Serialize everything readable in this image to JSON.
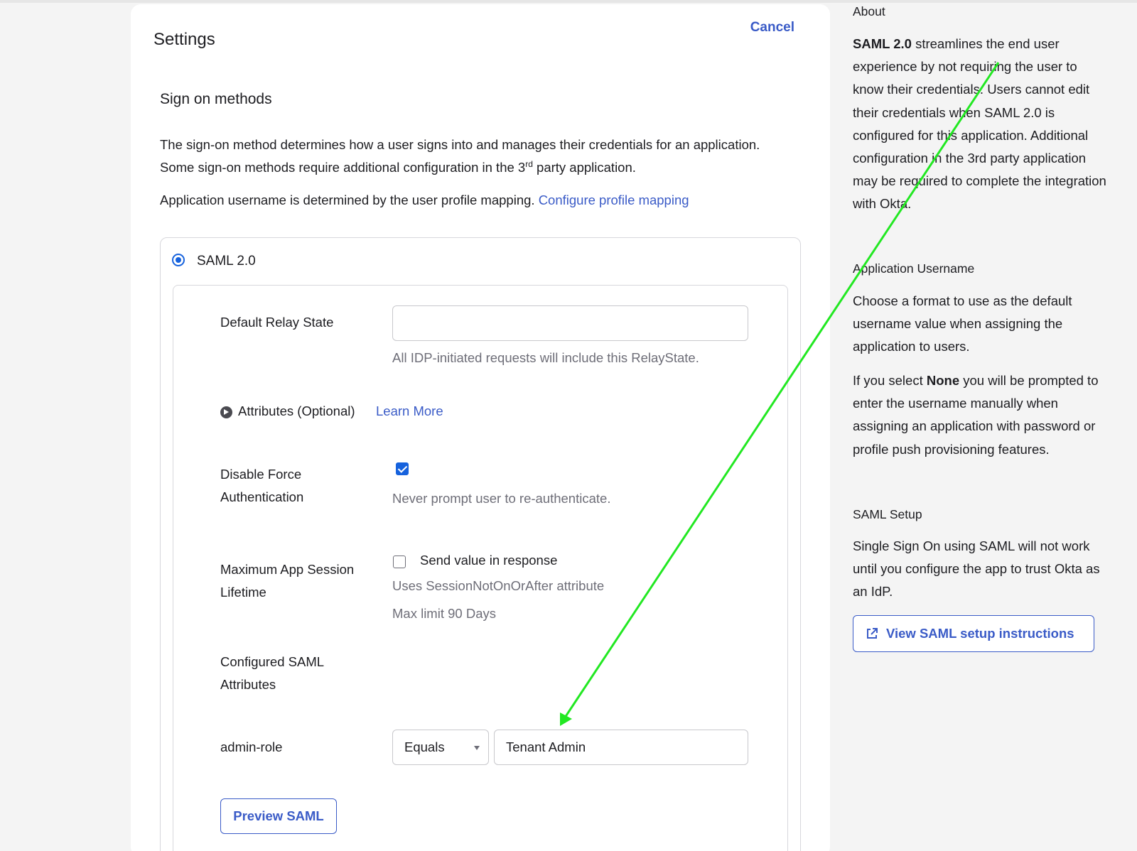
{
  "settings": {
    "title": "Settings",
    "cancel": "Cancel",
    "section_title": "Sign on methods",
    "desc_part1": "The sign-on method determines how a user signs into and manages their credentials for an application. Some sign-on methods require additional configuration in the 3",
    "desc_sup": "rd",
    "desc_part2": " party application.",
    "username_text": "Application username is determined by the user profile mapping. ",
    "username_link": "Configure profile mapping"
  },
  "saml": {
    "radio_label": "SAML 2.0",
    "relay_label": "Default Relay State",
    "relay_value": "",
    "relay_help": "All IDP-initiated requests will include this RelayState.",
    "attributes_label": "Attributes (Optional)",
    "learn_more": "Learn More",
    "force_auth_label_line1": "Disable Force",
    "force_auth_label_line2": "Authentication",
    "force_auth_checked": true,
    "force_auth_help": "Never prompt user to re-authenticate.",
    "session_label_line1": "Maximum App Session",
    "session_label_line2": "Lifetime",
    "session_check_label": "Send value in response",
    "session_help1": "Uses SessionNotOnOrAfter attribute",
    "session_help2": "Max limit 90 Days",
    "configured_line1": "Configured SAML",
    "configured_line2": "Attributes",
    "attr_name": "admin-role",
    "operator": "Equals",
    "attr_value": "Tenant Admin",
    "preview_button": "Preview SAML"
  },
  "sidebar": {
    "about_title": "About",
    "about_bold": "SAML 2.0",
    "about_text": " streamlines the end user experience by not requiring the user to know their credentials. Users cannot edit their credentials when SAML 2.0 is configured for this application. Additional configuration in the 3rd party application may be required to complete the integration with Okta.",
    "username_title": "Application Username",
    "username_text": "Choose a format to use as the default username value when assigning the application to users.",
    "none_pre": "If you select ",
    "none_bold": "None",
    "none_post": " you will be prompted to enter the username manually when assigning an application with password or profile push provisioning features.",
    "setup_title": "SAML Setup",
    "setup_text": "Single Sign On using SAML will not work until you configure the app to trust Okta as an IdP.",
    "setup_button": "View SAML setup instructions"
  },
  "colors": {
    "link": "#3a5bc7",
    "checkbox": "#1662dd",
    "annotation_arrow": "#22e822"
  },
  "icons": [
    "chevron-right-icon",
    "external-link-icon",
    "dropdown-arrow-icon"
  ]
}
